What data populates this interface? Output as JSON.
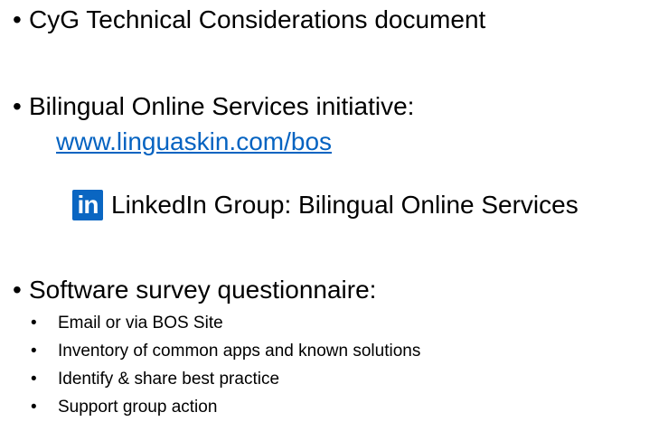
{
  "bullets": [
    {
      "bullet": "•",
      "text": "CyG Technical Considerations document"
    },
    {
      "bullet": "•",
      "text": "Bilingual Online Services initiative:"
    },
    {
      "bullet": "•",
      "text": "Software survey questionnaire:"
    }
  ],
  "link": {
    "text": "www.linguaskin.com/bos"
  },
  "linkedin": {
    "logo_text": "in",
    "icon": "linkedin-icon",
    "brand_color": "#0a66c2",
    "text": "LinkedIn Group: Bilingual Online Services"
  },
  "sub_items": [
    {
      "bullet": "•",
      "text": "Email or via BOS Site"
    },
    {
      "bullet": "•",
      "text": "Inventory of common apps and known solutions"
    },
    {
      "bullet": "•",
      "text": "Identify & share best practice"
    },
    {
      "bullet": "•",
      "text": "Support group action"
    }
  ],
  "colors": {
    "link": "#0563c1",
    "text": "#000000",
    "background": "#ffffff"
  }
}
